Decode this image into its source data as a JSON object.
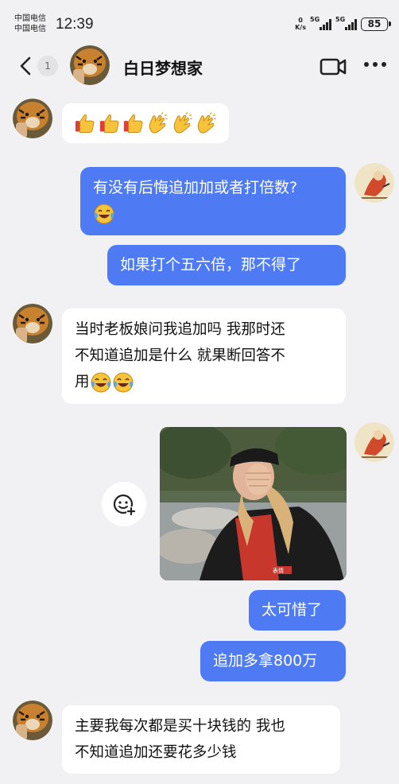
{
  "status_bar": {
    "carrier_1": "中国电信",
    "carrier_2": "中国电信",
    "time": "12:39",
    "net_speed_value": "0",
    "net_speed_unit": "K/s",
    "signal_1_tag": "5G",
    "signal_2_tag": "5G",
    "battery": "85"
  },
  "header": {
    "unread_count": "1",
    "contact_name": "白日梦想家",
    "icons": [
      "back-chevron-icon",
      "video-call-icon",
      "more-icon"
    ]
  },
  "messages": [
    {
      "from": "contact",
      "kind": "emoji",
      "emojis": [
        "thumbs-up",
        "thumbs-up",
        "thumbs-up",
        "clapping-hands",
        "clapping-hands",
        "clapping-hands"
      ]
    },
    {
      "from": "me",
      "kind": "text",
      "text": "有没有后悔追加加或者打倍数?",
      "emoji_after": "tears-of-joy"
    },
    {
      "from": "me",
      "kind": "text",
      "text": "如果打个五六倍，那不得了"
    },
    {
      "from": "contact",
      "kind": "text",
      "text_line1": "当时老板娘问我追加吗 我那时还",
      "text_line2": "不知道追加是什么 就果断回答不",
      "text_line3": "用",
      "emoji_after": "tears-of-joy"
    },
    {
      "from": "me",
      "kind": "image",
      "image_watermark": "表情",
      "side_action": "add-sticker-icon"
    },
    {
      "from": "me",
      "kind": "text",
      "text": "太可惜了"
    },
    {
      "from": "me",
      "kind": "text",
      "text": "追加多拿800万"
    },
    {
      "from": "contact",
      "kind": "text",
      "text_line1": "主要我每次都是买十块钱的 我也",
      "text_line2": "不知道追加还要花多少钱"
    }
  ],
  "colors": {
    "background": "#f1f1f3",
    "outgoing_bubble": "#4e7bf4",
    "incoming_bubble": "#ffffff"
  }
}
